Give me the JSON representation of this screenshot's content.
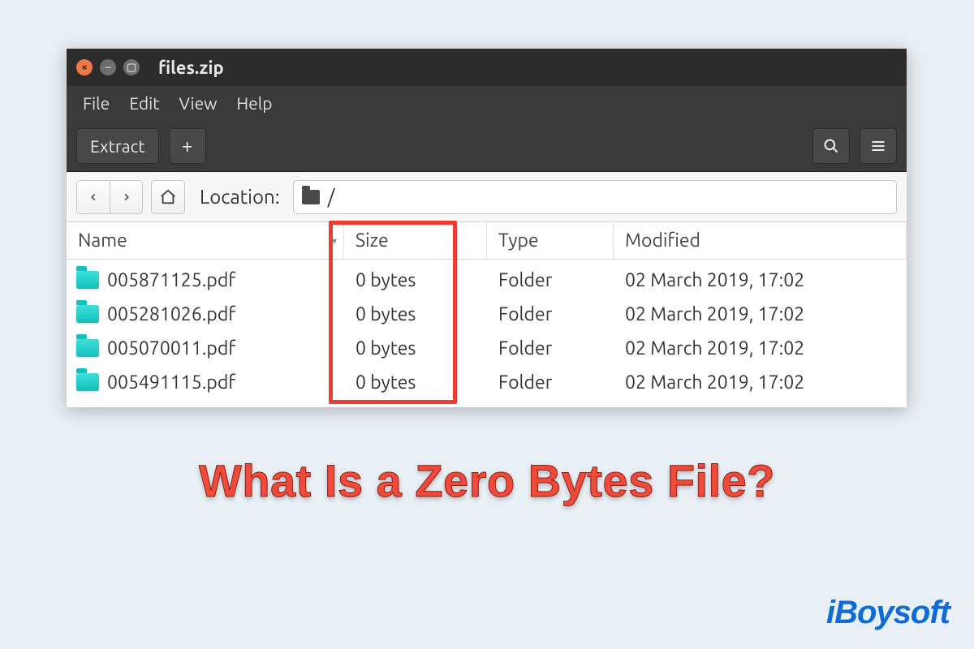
{
  "window": {
    "title": "files.zip"
  },
  "menu": {
    "items": [
      "File",
      "Edit",
      "View",
      "Help"
    ]
  },
  "toolbar": {
    "extract_label": "Extract",
    "add_label": "+",
    "search_label": "Search",
    "menu_label": "Menu"
  },
  "location": {
    "label": "Location:",
    "path": "/"
  },
  "columns": {
    "name": "Name",
    "size": "Size",
    "type": "Type",
    "modified": "Modified"
  },
  "files": [
    {
      "name": "005871125.pdf",
      "size": "0 bytes",
      "type": "Folder",
      "modified": "02 March 2019, 17:02"
    },
    {
      "name": "005281026.pdf",
      "size": "0 bytes",
      "type": "Folder",
      "modified": "02 March 2019, 17:02"
    },
    {
      "name": "005070011.pdf",
      "size": "0 bytes",
      "type": "Folder",
      "modified": "02 March 2019, 17:02"
    },
    {
      "name": "005491115.pdf",
      "size": "0 bytes",
      "type": "Folder",
      "modified": "02 March 2019, 17:02"
    }
  ],
  "caption": "What Is a Zero Bytes File?",
  "watermark": "iBoysoft"
}
